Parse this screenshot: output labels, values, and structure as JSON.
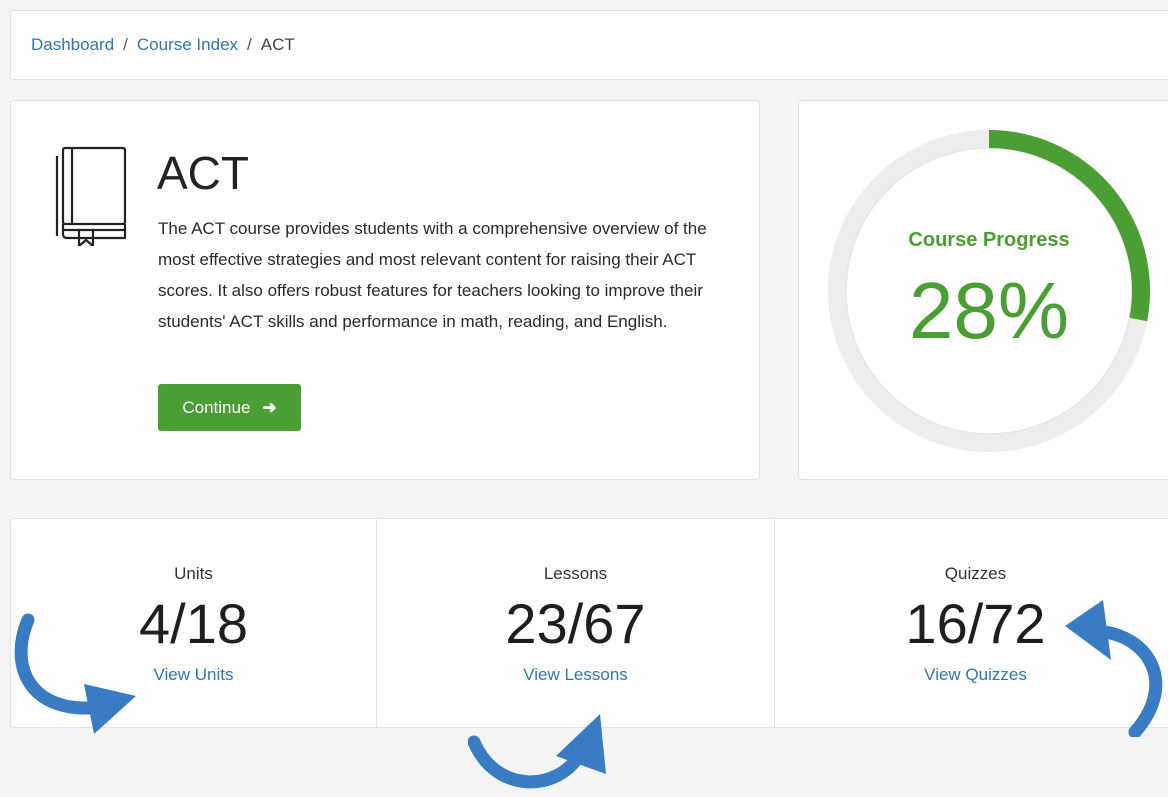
{
  "breadcrumb": {
    "items": [
      {
        "label": "Dashboard"
      },
      {
        "label": "Course Index"
      },
      {
        "label": "ACT"
      }
    ],
    "separator": "/"
  },
  "course": {
    "title": "ACT",
    "description": "The ACT course provides students with a comprehensive overview of the most effective strategies and most relevant content for raising their ACT scores. It also offers robust features for teachers looking to improve their students' ACT skills and performance in math, reading, and English.",
    "icon": "book-icon",
    "continue_label": "Continue",
    "continue_icon": "arrow-right-icon"
  },
  "progress": {
    "label": "Course Progress",
    "value_text": "28%",
    "fraction": 0.28
  },
  "stats": [
    {
      "label": "Units",
      "value": "4/18",
      "link": "View Units"
    },
    {
      "label": "Lessons",
      "value": "23/67",
      "link": "View Lessons"
    },
    {
      "label": "Quizzes",
      "value": "16/72",
      "link": "View Quizzes"
    }
  ],
  "colors": {
    "accent_green": "#4b9e33",
    "link_blue": "#2e77b8",
    "annotation_arrow_blue": "#3a7cc4",
    "ring_track": "#ededed"
  }
}
